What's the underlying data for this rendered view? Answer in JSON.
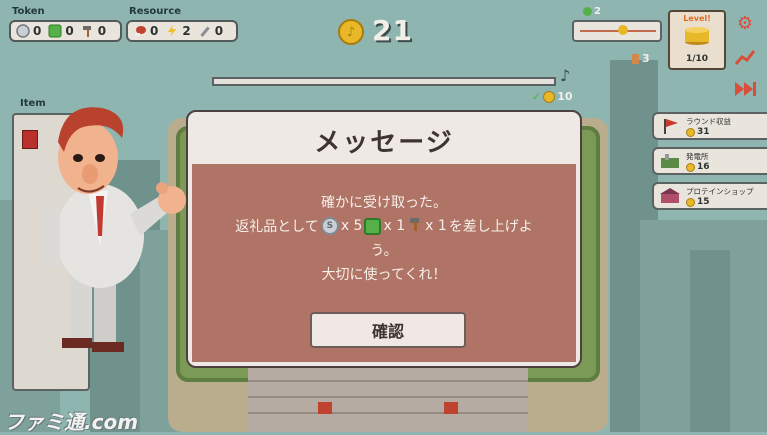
{
  "hud": {
    "token_label": "Token",
    "resource_label": "Resource",
    "tokens": [
      {
        "icon": "silver-coin-icon",
        "value": "0"
      },
      {
        "icon": "recycle-icon",
        "value": "0"
      },
      {
        "icon": "hammer-icon",
        "value": "0"
      }
    ],
    "resources": [
      {
        "icon": "meat-icon",
        "value": "0"
      },
      {
        "icon": "lightning-icon",
        "value": "2"
      },
      {
        "icon": "wrench-icon",
        "value": "0"
      }
    ],
    "coins": "21",
    "population": "2",
    "workers": "3",
    "target_value": "10"
  },
  "level": {
    "title": "Level!",
    "progress": "1/10"
  },
  "shop": [
    {
      "name": "ラウンド収益",
      "cost": "31",
      "color": "#c83a2e"
    },
    {
      "name": "発電所",
      "cost": "16",
      "color": "#5a8a44"
    },
    {
      "name": "プロテインショップ",
      "cost": "15",
      "color": "#b04f6a"
    }
  ],
  "item_panel": {
    "label": "Item"
  },
  "dialog": {
    "title": "メッセージ",
    "line1": "確かに受け取った。",
    "line2_prefix": "返礼品として",
    "silver_count": "x 5",
    "recycle_count": "x 1",
    "hammer_count": "x 1",
    "line2_suffix": "を差し上げよ",
    "line3": "う。",
    "line4": "大切に使ってくれ！",
    "confirm": "確認"
  },
  "watermark": "ファミ通.com",
  "colors": {
    "accent": "#d94e3a",
    "coin": "#e8b828",
    "dialog_body": "#b07466"
  }
}
